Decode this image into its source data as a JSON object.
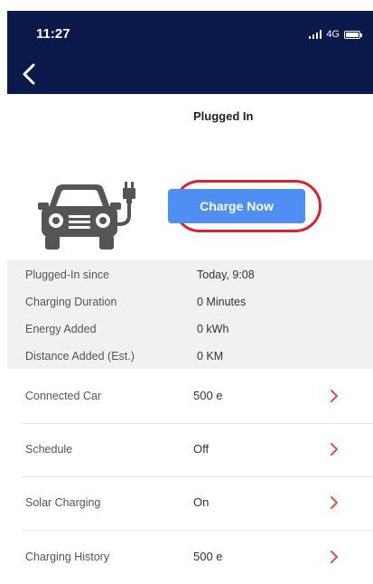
{
  "status_bar": {
    "time": "11:27",
    "network": "4G"
  },
  "nav": {
    "back_icon": "chevron-left-icon"
  },
  "page": {
    "title": "Plugged In"
  },
  "action": {
    "charge_label": "Charge Now"
  },
  "info": [
    {
      "label": "Plugged-In since",
      "value": "Today, 9:08"
    },
    {
      "label": "Charging Duration",
      "value": "0 Minutes"
    },
    {
      "label": "Energy Added",
      "value": "0 kWh"
    },
    {
      "label": "Distance Added (Est.)",
      "value": "0 KM"
    }
  ],
  "menu": [
    {
      "label": "Connected Car",
      "value": "500 e"
    },
    {
      "label": "Schedule",
      "value": "Off"
    },
    {
      "label": "Solar Charging",
      "value": "On"
    },
    {
      "label": "Charging History",
      "value": "500 e"
    }
  ],
  "colors": {
    "header": "#0b1a4a",
    "button": "#4f8ef3",
    "highlight": "#d8232a",
    "chevron": "#e05050"
  },
  "icons": [
    "signal-icon",
    "battery-icon",
    "car-plug-icon",
    "chevron-right-icon"
  ]
}
